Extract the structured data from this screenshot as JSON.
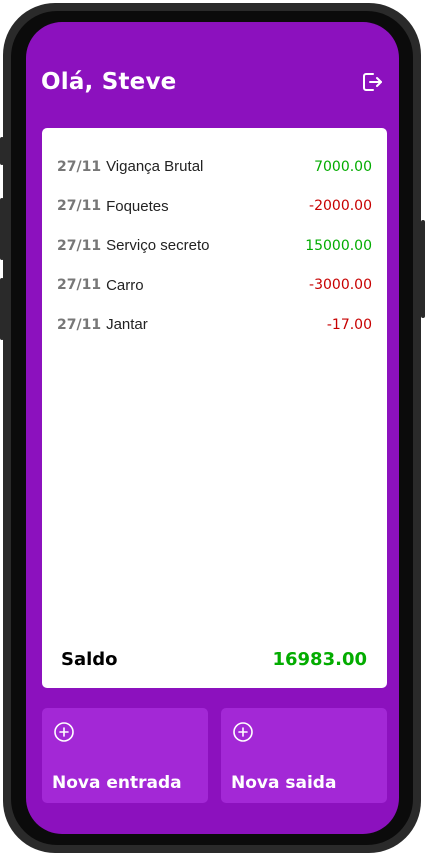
{
  "header": {
    "greeting": "Olá, Steve",
    "logout_icon": "logout-icon"
  },
  "transactions": [
    {
      "date": "27/11",
      "description": "Vigança Brutal",
      "value": "7000.00",
      "type": "income"
    },
    {
      "date": "27/11",
      "description": "Foquetes",
      "value": "-2000.00",
      "type": "expense"
    },
    {
      "date": "27/11",
      "description": "Serviço secreto",
      "value": "15000.00",
      "type": "income"
    },
    {
      "date": "27/11",
      "description": "Carro",
      "value": "-3000.00",
      "type": "expense"
    },
    {
      "date": "27/11",
      "description": "Jantar",
      "value": "-17.00",
      "type": "expense"
    }
  ],
  "balance": {
    "label": "Saldo",
    "value": "16983.00"
  },
  "actions": {
    "new_income": {
      "label": "Nova entrada",
      "icon": "plus-circle-icon"
    },
    "new_expense": {
      "label": "Nova saida",
      "icon": "plus-circle-icon"
    }
  },
  "colors": {
    "background": "#8c11be",
    "button": "#a328d6",
    "positive": "#03ac00",
    "negative": "#c70000"
  }
}
